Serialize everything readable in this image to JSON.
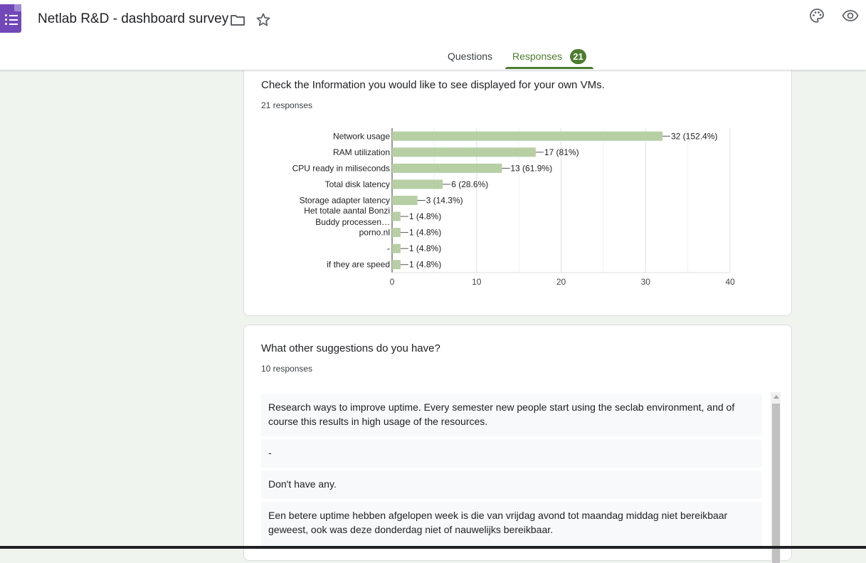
{
  "header": {
    "title": "Netlab R&D - dashboard survey",
    "tabs": [
      {
        "label": "Questions"
      },
      {
        "label": "Responses",
        "badge": "21"
      }
    ],
    "accent_color": "#4d7c2e"
  },
  "questions": [
    {
      "title": "Check the Information you would like to see displayed for your own VMs.",
      "response_count": "21 responses"
    },
    {
      "title": "What other suggestions do you have?",
      "response_count": "10 responses",
      "responses": [
        "Research ways to improve uptime. Every semester new people start using the seclab environment, and of course this results in high usage of the resources.",
        "-",
        "Don't have any.",
        "Een betere uptime hebben afgelopen week is die van vrijdag avond tot maandag middag niet bereikbaar geweest, ook was deze donderdag niet of nauwelijks bereikbaar."
      ]
    }
  ],
  "chart_data": {
    "type": "bar",
    "orientation": "horizontal",
    "categories": [
      "Network usage",
      "RAM utilization",
      "CPU ready in miliseconds",
      "Total disk latency",
      "Storage adapter latency",
      "Het totale aantal Bonzi Buddy processen…",
      "porno.nl",
      "-",
      "if they are speed"
    ],
    "values": [
      32,
      17,
      13,
      6,
      3,
      1,
      1,
      1,
      1
    ],
    "data_labels": [
      "32 (152.4%)",
      "17 (81%)",
      "13 (61.9%)",
      "6 (28.6%)",
      "3 (14.3%)",
      "1 (4.8%)",
      "1 (4.8%)",
      "1 (4.8%)",
      "1 (4.8%)"
    ],
    "xlim": [
      0,
      40
    ],
    "xticks": [
      "0",
      "10",
      "20",
      "30",
      "40"
    ],
    "bar_color": "#b7cfa4",
    "grid": true
  }
}
